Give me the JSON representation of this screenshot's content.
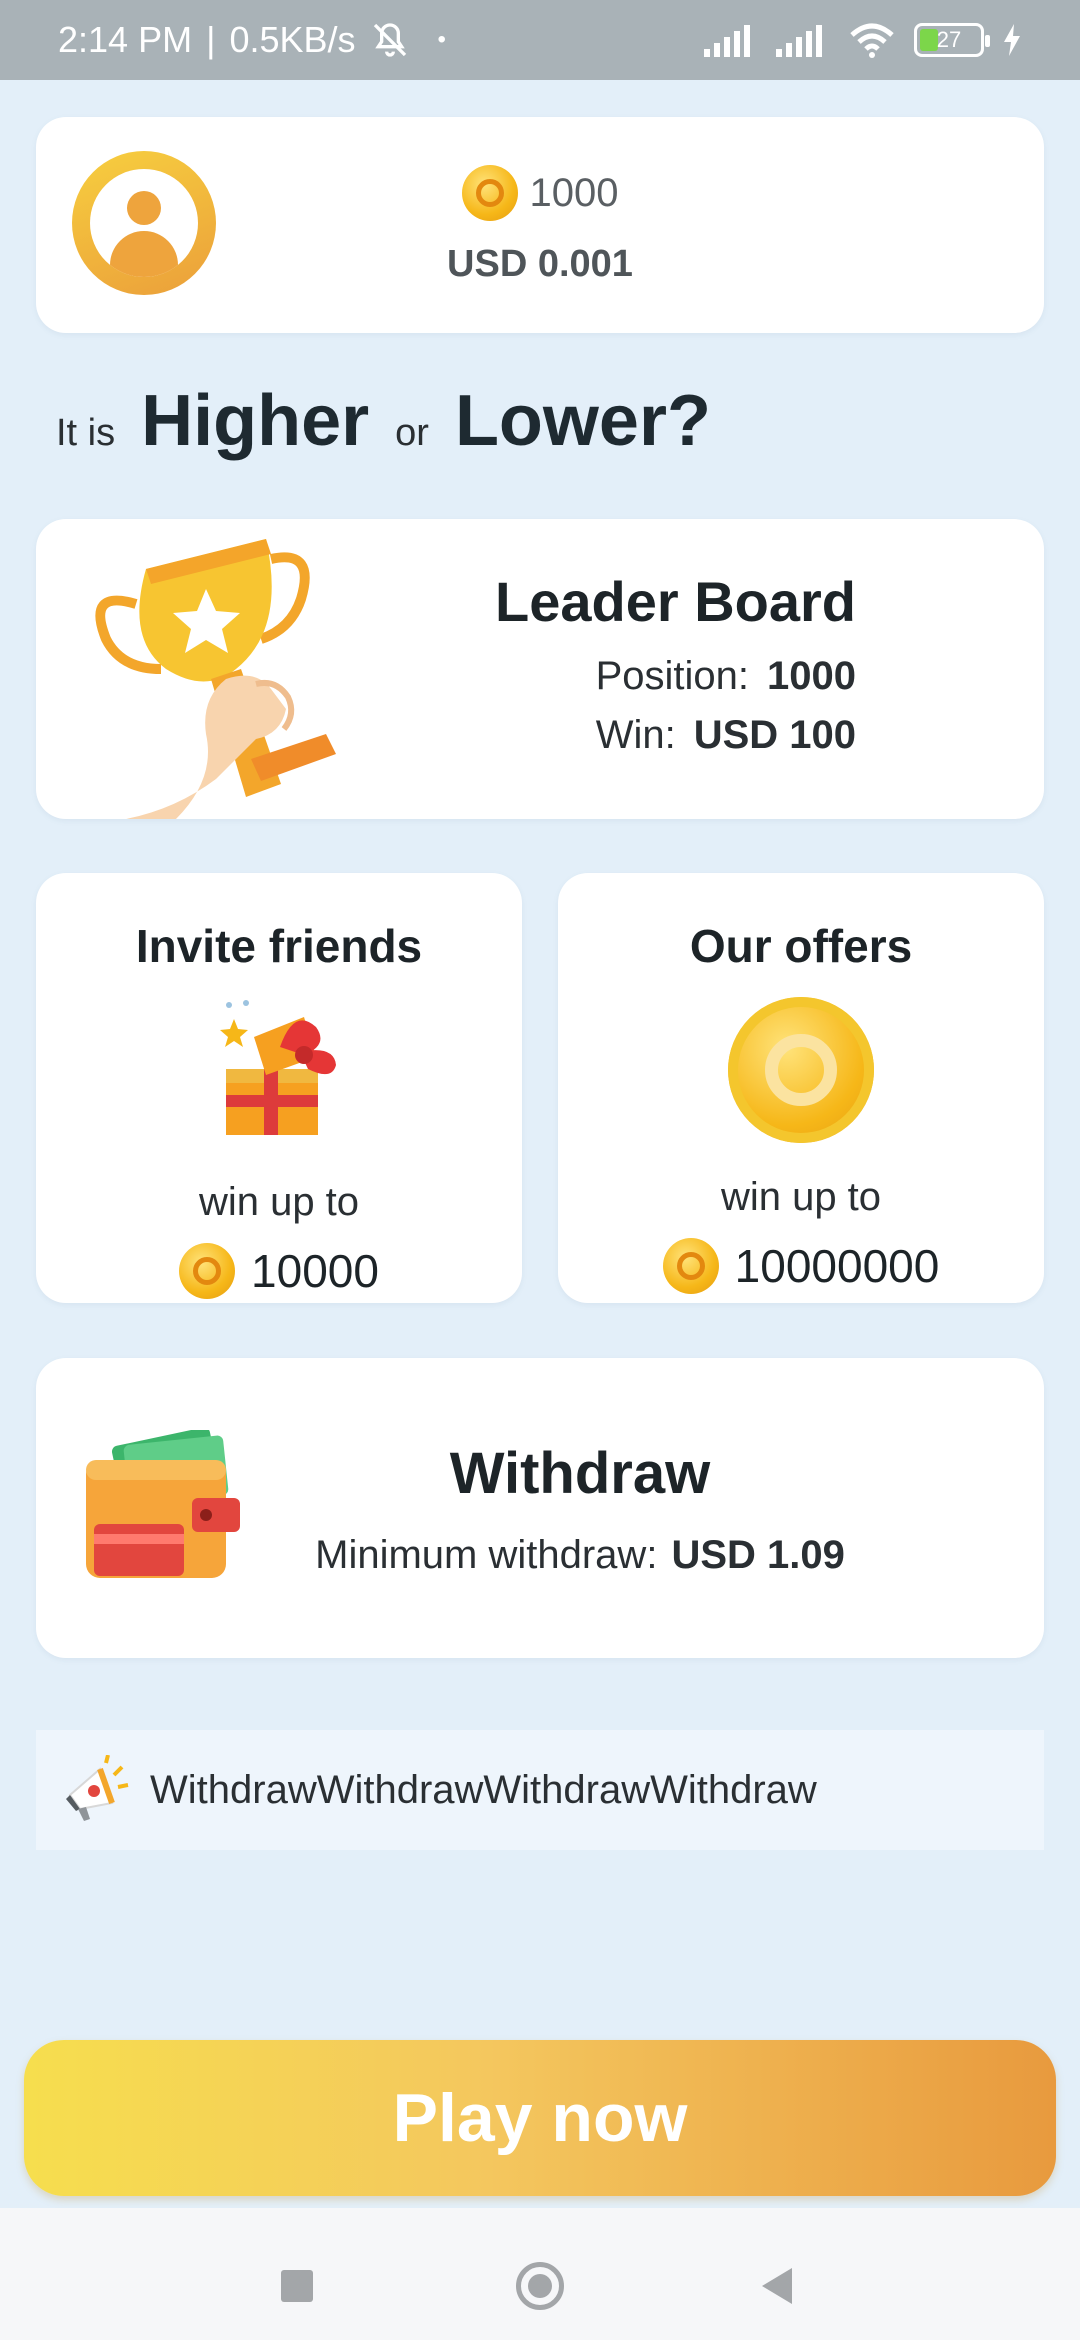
{
  "status_bar": {
    "time": "2:14 PM",
    "speed": "0.5KB/s",
    "battery": "27"
  },
  "profile": {
    "coins": "1000",
    "usd": "USD 0.001"
  },
  "headline": {
    "it_is": "It is",
    "higher": "Higher",
    "or": "or",
    "lower": "Lower?"
  },
  "leaderboard": {
    "title": "Leader Board",
    "position_label": "Position:",
    "position_value": "1000",
    "win_label": "Win:",
    "win_value": "USD 100"
  },
  "invite": {
    "title": "Invite friends",
    "sub": "win up to",
    "amount": "10000"
  },
  "offers": {
    "title": "Our offers",
    "sub": "win up to",
    "amount": "10000000"
  },
  "withdraw": {
    "title": "Withdraw",
    "min_label": "Minimum withdraw:",
    "min_value": "USD 1.09"
  },
  "marquee": {
    "text": "WithdrawWithdrawWithdrawWithdraw"
  },
  "play_button": {
    "label": "Play now"
  },
  "colors": {
    "background": "#e3eff9",
    "accent_start": "#f6de4e",
    "accent_end": "#e89a3e",
    "coin": "#f6b718"
  }
}
